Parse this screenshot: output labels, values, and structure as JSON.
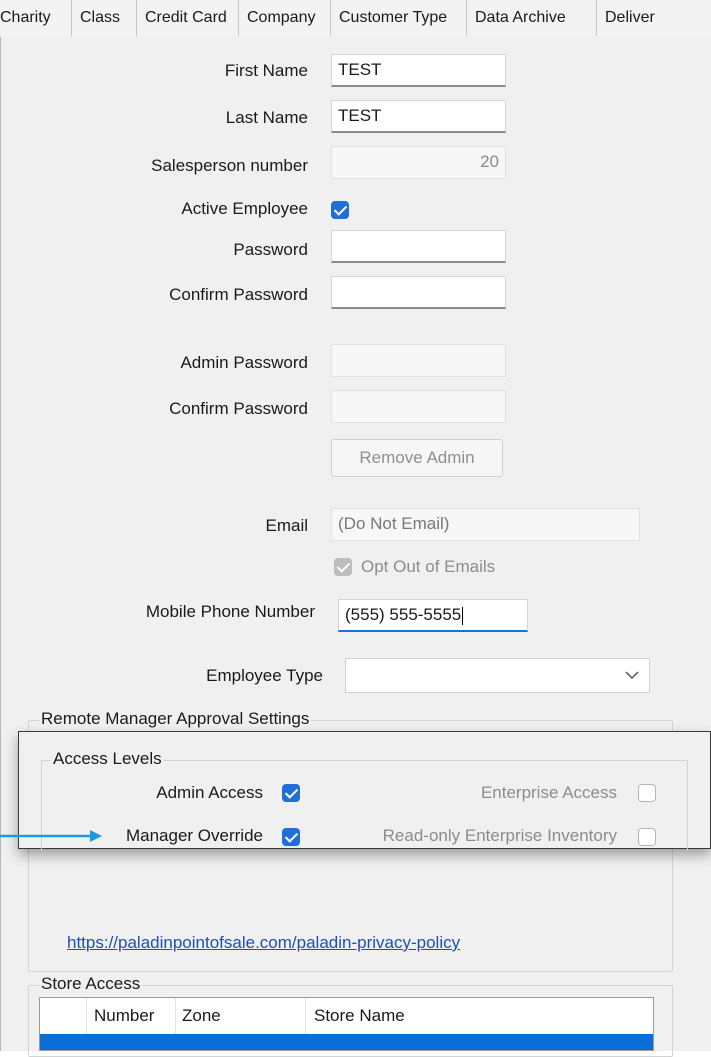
{
  "tabs": [
    "Charity",
    "Class",
    "Credit Card",
    "Company",
    "Customer Type",
    "Data Archive",
    "Deliver"
  ],
  "form": {
    "first_name_label": "First Name",
    "first_name_value": "TEST",
    "last_name_label": "Last Name",
    "last_name_value": "TEST",
    "salesperson_label": "Salesperson number",
    "salesperson_value": "20",
    "active_employee_label": "Active Employee",
    "password_label": "Password",
    "confirm_password_label": "Confirm Password",
    "admin_password_label": "Admin Password",
    "admin_confirm_password_label": "Confirm Password",
    "remove_admin_label": "Remove Admin",
    "email_label": "Email",
    "email_value": "(Do Not Email)",
    "opt_out_label": "Opt Out of Emails",
    "mobile_label": "Mobile Phone Number",
    "mobile_value": "(555) 555-5555",
    "employee_type_label": "Employee Type",
    "employee_type_value": ""
  },
  "remote_manager": {
    "title": "Remote Manager Approval Settings"
  },
  "access_levels": {
    "title": "Access Levels",
    "admin_access": "Admin Access",
    "manager_override": "Manager Override",
    "enterprise_access": "Enterprise Access",
    "readonly_enterprise": "Read-only Enterprise Inventory"
  },
  "privacy_link": "https://paladinpointofsale.com/paladin-privacy-policy",
  "store_access": {
    "title": "Store Access",
    "columns": [
      "Number",
      "Zone",
      "Store Name"
    ]
  },
  "colors": {
    "accent": "#1f6fd6",
    "arrow": "#1a9be0",
    "link": "#1d4fb8"
  }
}
